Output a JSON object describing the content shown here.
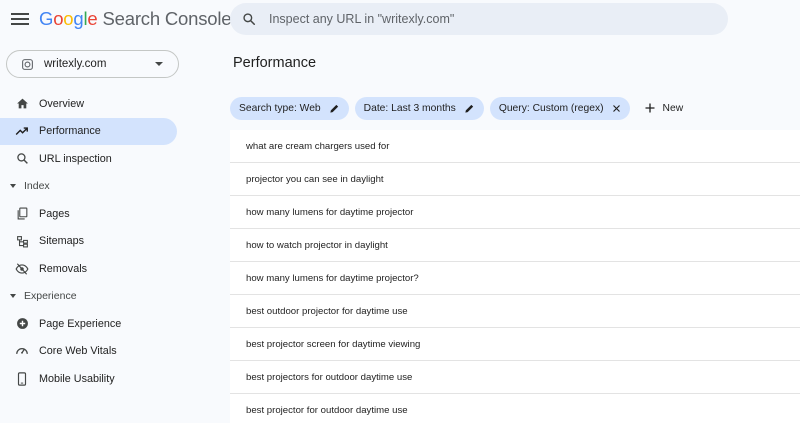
{
  "header": {
    "logo_letters": [
      "G",
      "o",
      "o",
      "g",
      "l",
      "e"
    ],
    "logo_product": "Search Console",
    "search_placeholder": "Inspect any URL in \"writexly.com\""
  },
  "property": {
    "label": "writexly.com"
  },
  "sidebar": {
    "items_top": [
      {
        "label": "Overview",
        "icon": "home-icon",
        "active": false
      },
      {
        "label": "Performance",
        "icon": "trending-up-icon",
        "active": true
      },
      {
        "label": "URL inspection",
        "icon": "search-icon",
        "active": false
      }
    ],
    "index_section": "Index",
    "index_items": [
      {
        "label": "Pages",
        "icon": "pages-icon"
      },
      {
        "label": "Sitemaps",
        "icon": "sitemap-icon"
      },
      {
        "label": "Removals",
        "icon": "removals-icon"
      }
    ],
    "experience_section": "Experience",
    "experience_items": [
      {
        "label": "Page Experience",
        "icon": "plus-circle-icon"
      },
      {
        "label": "Core Web Vitals",
        "icon": "speedometer-icon"
      },
      {
        "label": "Mobile Usability",
        "icon": "smartphone-icon"
      }
    ]
  },
  "main": {
    "title": "Performance",
    "filters": [
      {
        "label": "Search type: Web",
        "action_icon": "edit-icon"
      },
      {
        "label": "Date: Last 3 months",
        "action_icon": "edit-icon"
      },
      {
        "label": "Query: Custom (regex)",
        "action_icon": "close-icon"
      }
    ],
    "new_label": "New",
    "queries": [
      "what are cream chargers used for",
      "projector you can see in daylight",
      "how many lumens for daytime projector",
      "how to watch projector in daylight",
      "how many lumens for daytime projector?",
      "best outdoor projector for daytime use",
      "best projector screen for daytime viewing",
      "best projectors for outdoor daytime use",
      "best projector for outdoor daytime use"
    ]
  },
  "colors": {
    "background": "#f8fafd",
    "active_nav": "#d3e3fd",
    "chip": "#d3e3fd",
    "search_bg": "#e9eef6"
  }
}
